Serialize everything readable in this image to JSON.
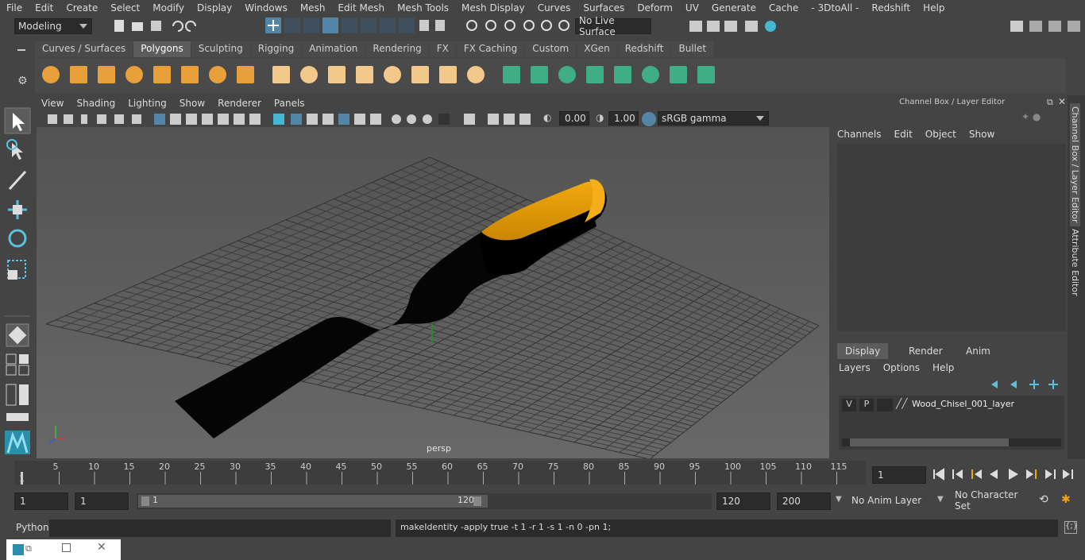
{
  "menu": [
    "File",
    "Edit",
    "Create",
    "Select",
    "Modify",
    "Display",
    "Windows",
    "Mesh",
    "Edit Mesh",
    "Mesh Tools",
    "Mesh Display",
    "Curves",
    "Surfaces",
    "Deform",
    "UV",
    "Generate",
    "Cache",
    "- 3DtoAll -",
    "Redshift",
    "Help"
  ],
  "toolbar": {
    "mode": "Modeling",
    "live_surface": "No Live Surface"
  },
  "shelf_tabs": [
    "Curves / Surfaces",
    "Polygons",
    "Sculpting",
    "Rigging",
    "Animation",
    "Rendering",
    "FX",
    "FX Caching",
    "Custom",
    "XGen",
    "Redshift",
    "Bullet"
  ],
  "shelf_active": "Polygons",
  "viewport_menu": [
    "View",
    "Shading",
    "Lighting",
    "Show",
    "Renderer",
    "Panels"
  ],
  "viewport_tools": {
    "exposure": "0.00",
    "gamma": "1.00",
    "color_space": "sRGB gamma"
  },
  "viewport_label": "persp",
  "channel_box": {
    "title": "Channel Box / Layer Editor",
    "menu": [
      "Channels",
      "Edit",
      "Object",
      "Show"
    ],
    "tabs": [
      "Display",
      "Render",
      "Anim"
    ],
    "active_tab": "Display",
    "layer_menu": [
      "Layers",
      "Options",
      "Help"
    ],
    "layer": {
      "v": "V",
      "p": "P",
      "name": "Wood_Chisel_001_layer"
    }
  },
  "side_tabs": [
    "Channel Box / Layer Editor",
    "Attribute Editor"
  ],
  "timeline": {
    "ticks": [
      "1",
      "5",
      "10",
      "15",
      "20",
      "25",
      "30",
      "35",
      "40",
      "45",
      "50",
      "55",
      "60",
      "65",
      "70",
      "75",
      "80",
      "85",
      "90",
      "95",
      "100",
      "105",
      "110",
      "115",
      "12"
    ],
    "current_frame": "1"
  },
  "range": {
    "start": "1",
    "playback_start": "1",
    "slider_start": "1",
    "slider_end": "120",
    "playback_end": "120",
    "end": "200",
    "anim_layer": "No Anim Layer",
    "character_set": "No Character Set"
  },
  "command": {
    "language": "Python",
    "result": "makeIdentity -apply true -t 1 -r 1 -s 1 -n 0 -pn 1;"
  },
  "colors": {
    "accent": "#5285a6",
    "handle": "#f0a30a",
    "shelf_orange": "#e8a13a",
    "shelf_green": "#3fae84"
  }
}
